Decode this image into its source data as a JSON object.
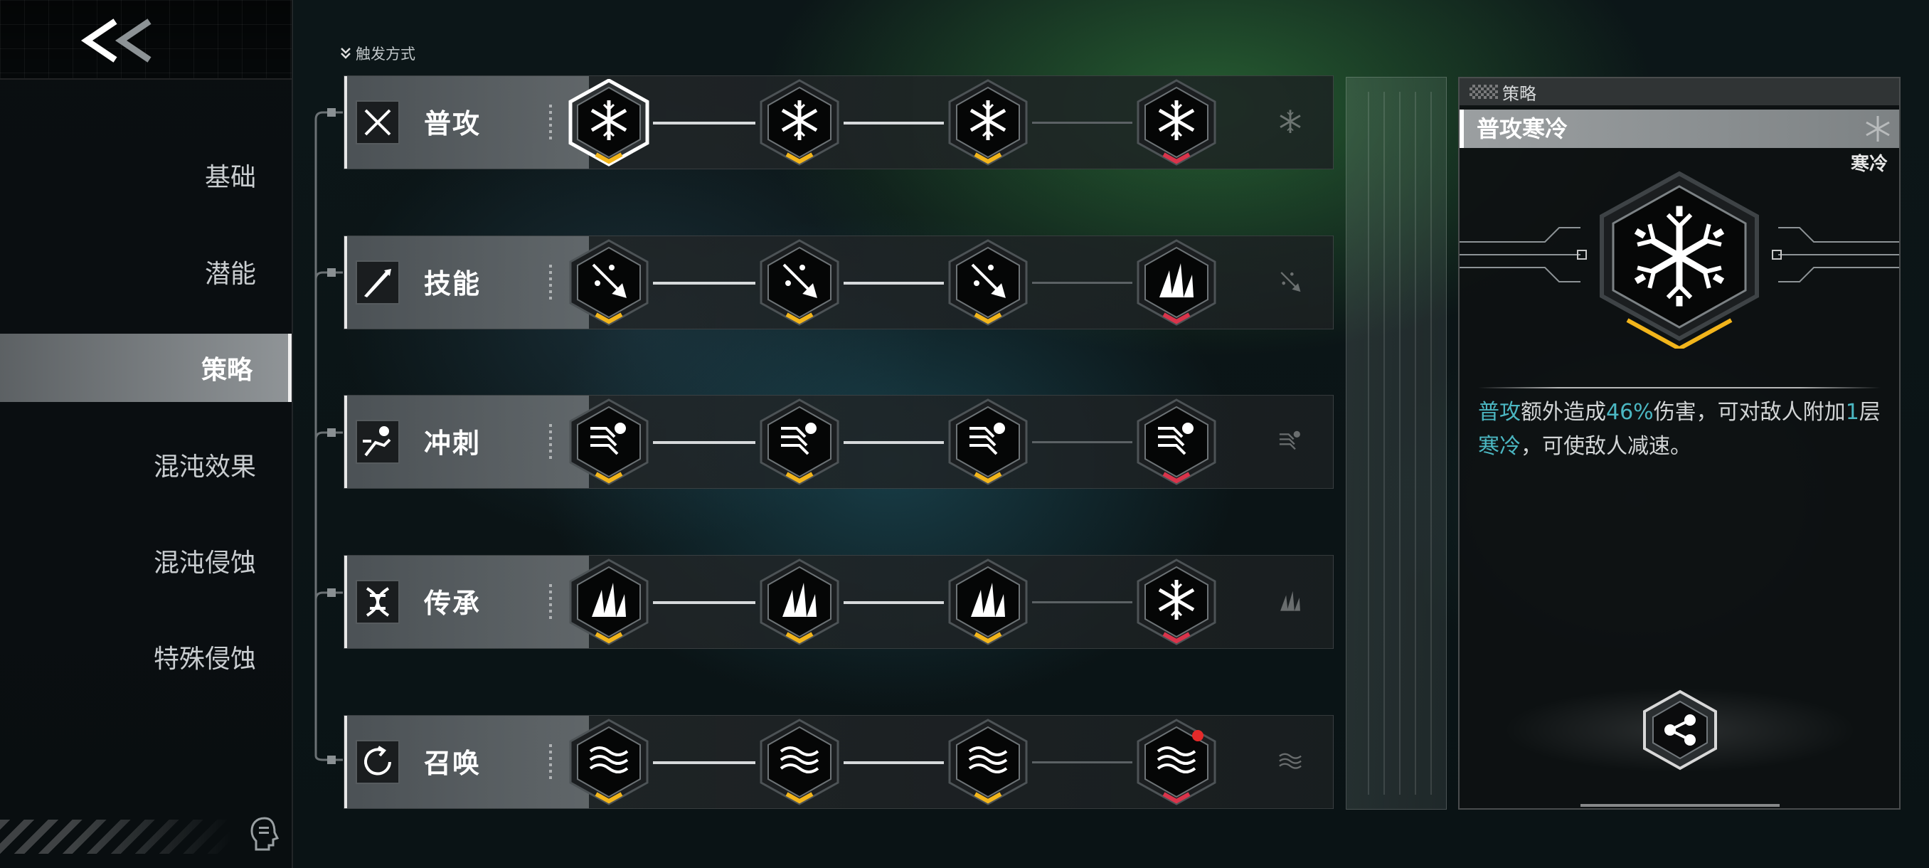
{
  "sidebar": {
    "back_label": "<<",
    "items": [
      {
        "label": "基础",
        "active": false
      },
      {
        "label": "潜能",
        "active": false
      },
      {
        "label": "策略",
        "active": true
      },
      {
        "label": "混沌效果",
        "active": false
      },
      {
        "label": "混沌侵蚀",
        "active": false
      },
      {
        "label": "特殊侵蚀",
        "active": false
      }
    ]
  },
  "trigger_label": "触发方式",
  "rows": [
    {
      "label": "普攻",
      "icon": "crossed-swords-icon",
      "nodes": [
        {
          "name": "snowflake-icon",
          "marker": "yellow",
          "selected": true
        },
        {
          "name": "snowflake-burst-icon",
          "marker": "yellow"
        },
        {
          "name": "snowflake-ring-icon",
          "marker": "yellow"
        },
        {
          "name": "snowflake-star-icon",
          "marker": "red"
        }
      ]
    },
    {
      "label": "技能",
      "icon": "arrow-slash-icon",
      "nodes": [
        {
          "name": "spear-spark-icon",
          "marker": "yellow"
        },
        {
          "name": "spear-up-icon",
          "marker": "yellow"
        },
        {
          "name": "spear-plus-icon",
          "marker": "yellow"
        },
        {
          "name": "ice-spikes-icon",
          "marker": "red"
        }
      ]
    },
    {
      "label": "冲刺",
      "icon": "dash-runner-icon",
      "nodes": [
        {
          "name": "dash-wings-icon",
          "marker": "yellow"
        },
        {
          "name": "dash-wings-up-icon",
          "marker": "yellow"
        },
        {
          "name": "dash-wings-plus-icon",
          "marker": "yellow"
        },
        {
          "name": "dash-waves-icon",
          "marker": "red"
        }
      ]
    },
    {
      "label": "传承",
      "icon": "dna-icon",
      "nodes": [
        {
          "name": "ice-shards-icon",
          "marker": "yellow"
        },
        {
          "name": "ice-shards-up-icon",
          "marker": "yellow"
        },
        {
          "name": "ice-shards-cross-icon",
          "marker": "yellow"
        },
        {
          "name": "snowflake-flame-icon",
          "marker": "red"
        }
      ]
    },
    {
      "label": "召唤",
      "icon": "summon-circle-icon",
      "nodes": [
        {
          "name": "wind-waves-icon",
          "marker": "yellow"
        },
        {
          "name": "wind-waves-target-icon",
          "marker": "yellow"
        },
        {
          "name": "wind-waves-plus-icon",
          "marker": "yellow"
        },
        {
          "name": "wind-waves-dot-icon",
          "marker": "red",
          "notify": true
        }
      ]
    }
  ],
  "detail": {
    "header": "策略",
    "title": "普攻寒冷",
    "subtitle": "寒冷",
    "desc": {
      "p1": "普攻",
      "p2": "额外造成",
      "p3": "46%",
      "p4": "伤害，可对敌人附加",
      "p5": "1",
      "p6": "层",
      "p7": "寒冷",
      "p8": "，可使敌人减速。"
    }
  },
  "colors": {
    "accent_yellow": "#f2b51b",
    "accent_red": "#d9344b",
    "highlight_teal": "#4bb7c2"
  }
}
